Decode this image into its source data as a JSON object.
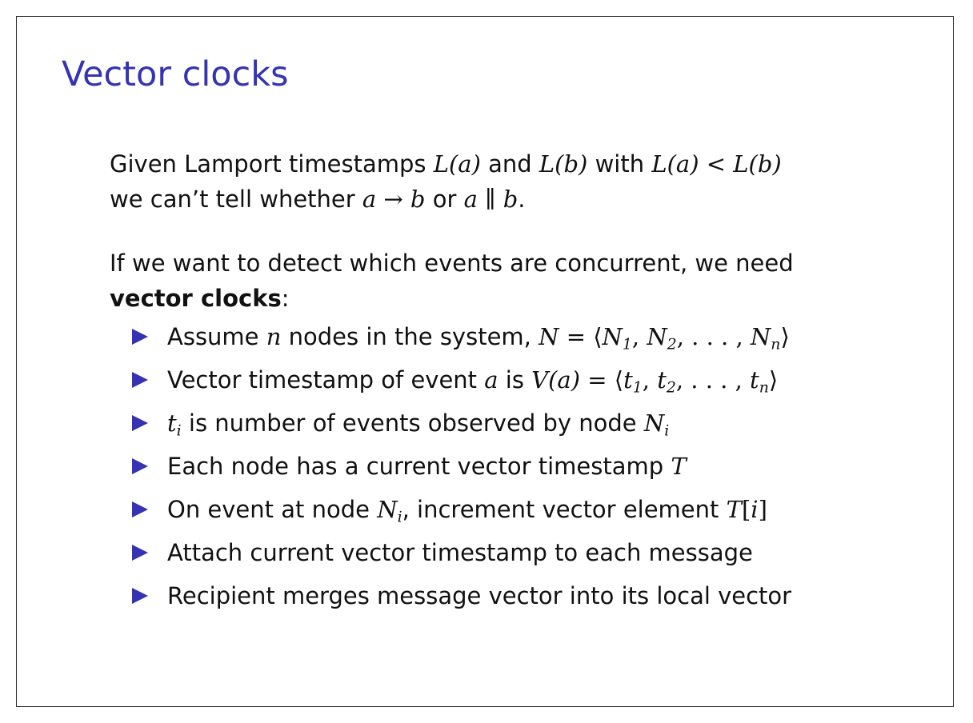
{
  "slide": {
    "title": "Vector clocks",
    "accent_color": "#3333b3",
    "para1": {
      "t1": "Given Lamport timestamps ",
      "m1": "L(a)",
      "t2": " and ",
      "m2": "L(b)",
      "t3": " with ",
      "m3": "L(a) < L(b)",
      "t4": "we can’t tell whether ",
      "m4": "a → b",
      "t5": " or ",
      "m5": "a ∥ b",
      "t6": "."
    },
    "para2": {
      "t1": "If we want to detect which events are concurrent, we need",
      "bold": "vector clocks",
      "t2": ":"
    },
    "bullets": {
      "b1": {
        "t1": "Assume ",
        "m1": "n",
        "t2": " nodes in the system, ",
        "m2a": "N",
        "m2b": " = ⟨",
        "n1": "N",
        "s1": "1",
        "c1": ", ",
        "n2": "N",
        "s2": "2",
        "c2": ", . . . , ",
        "n3": "N",
        "s3": "n",
        "close": "⟩"
      },
      "b2": {
        "t1": "Vector timestamp of event ",
        "m1": "a",
        "t2": " is ",
        "m2": "V(a)",
        "eq": " = ⟨",
        "v1": "t",
        "s1": "1",
        "c1": ", ",
        "v2": "t",
        "s2": "2",
        "c2": ", . . . , ",
        "v3": "t",
        "s3": "n",
        "close": "⟩"
      },
      "b3": {
        "m1": "t",
        "s1": "i",
        "t1": " is number of events observed by node ",
        "m2": "N",
        "s2": "i"
      },
      "b4": {
        "t1": "Each node has a current vector timestamp ",
        "m1": "T"
      },
      "b5": {
        "t1": "On event at node ",
        "m1": "N",
        "s1": "i",
        "t2": ", increment vector element ",
        "m2": "T",
        "br1": "[",
        "m3": "i",
        "br2": "]"
      },
      "b6": {
        "t1": "Attach current vector timestamp to each message"
      },
      "b7": {
        "t1": "Recipient merges message vector into its local vector"
      }
    }
  }
}
